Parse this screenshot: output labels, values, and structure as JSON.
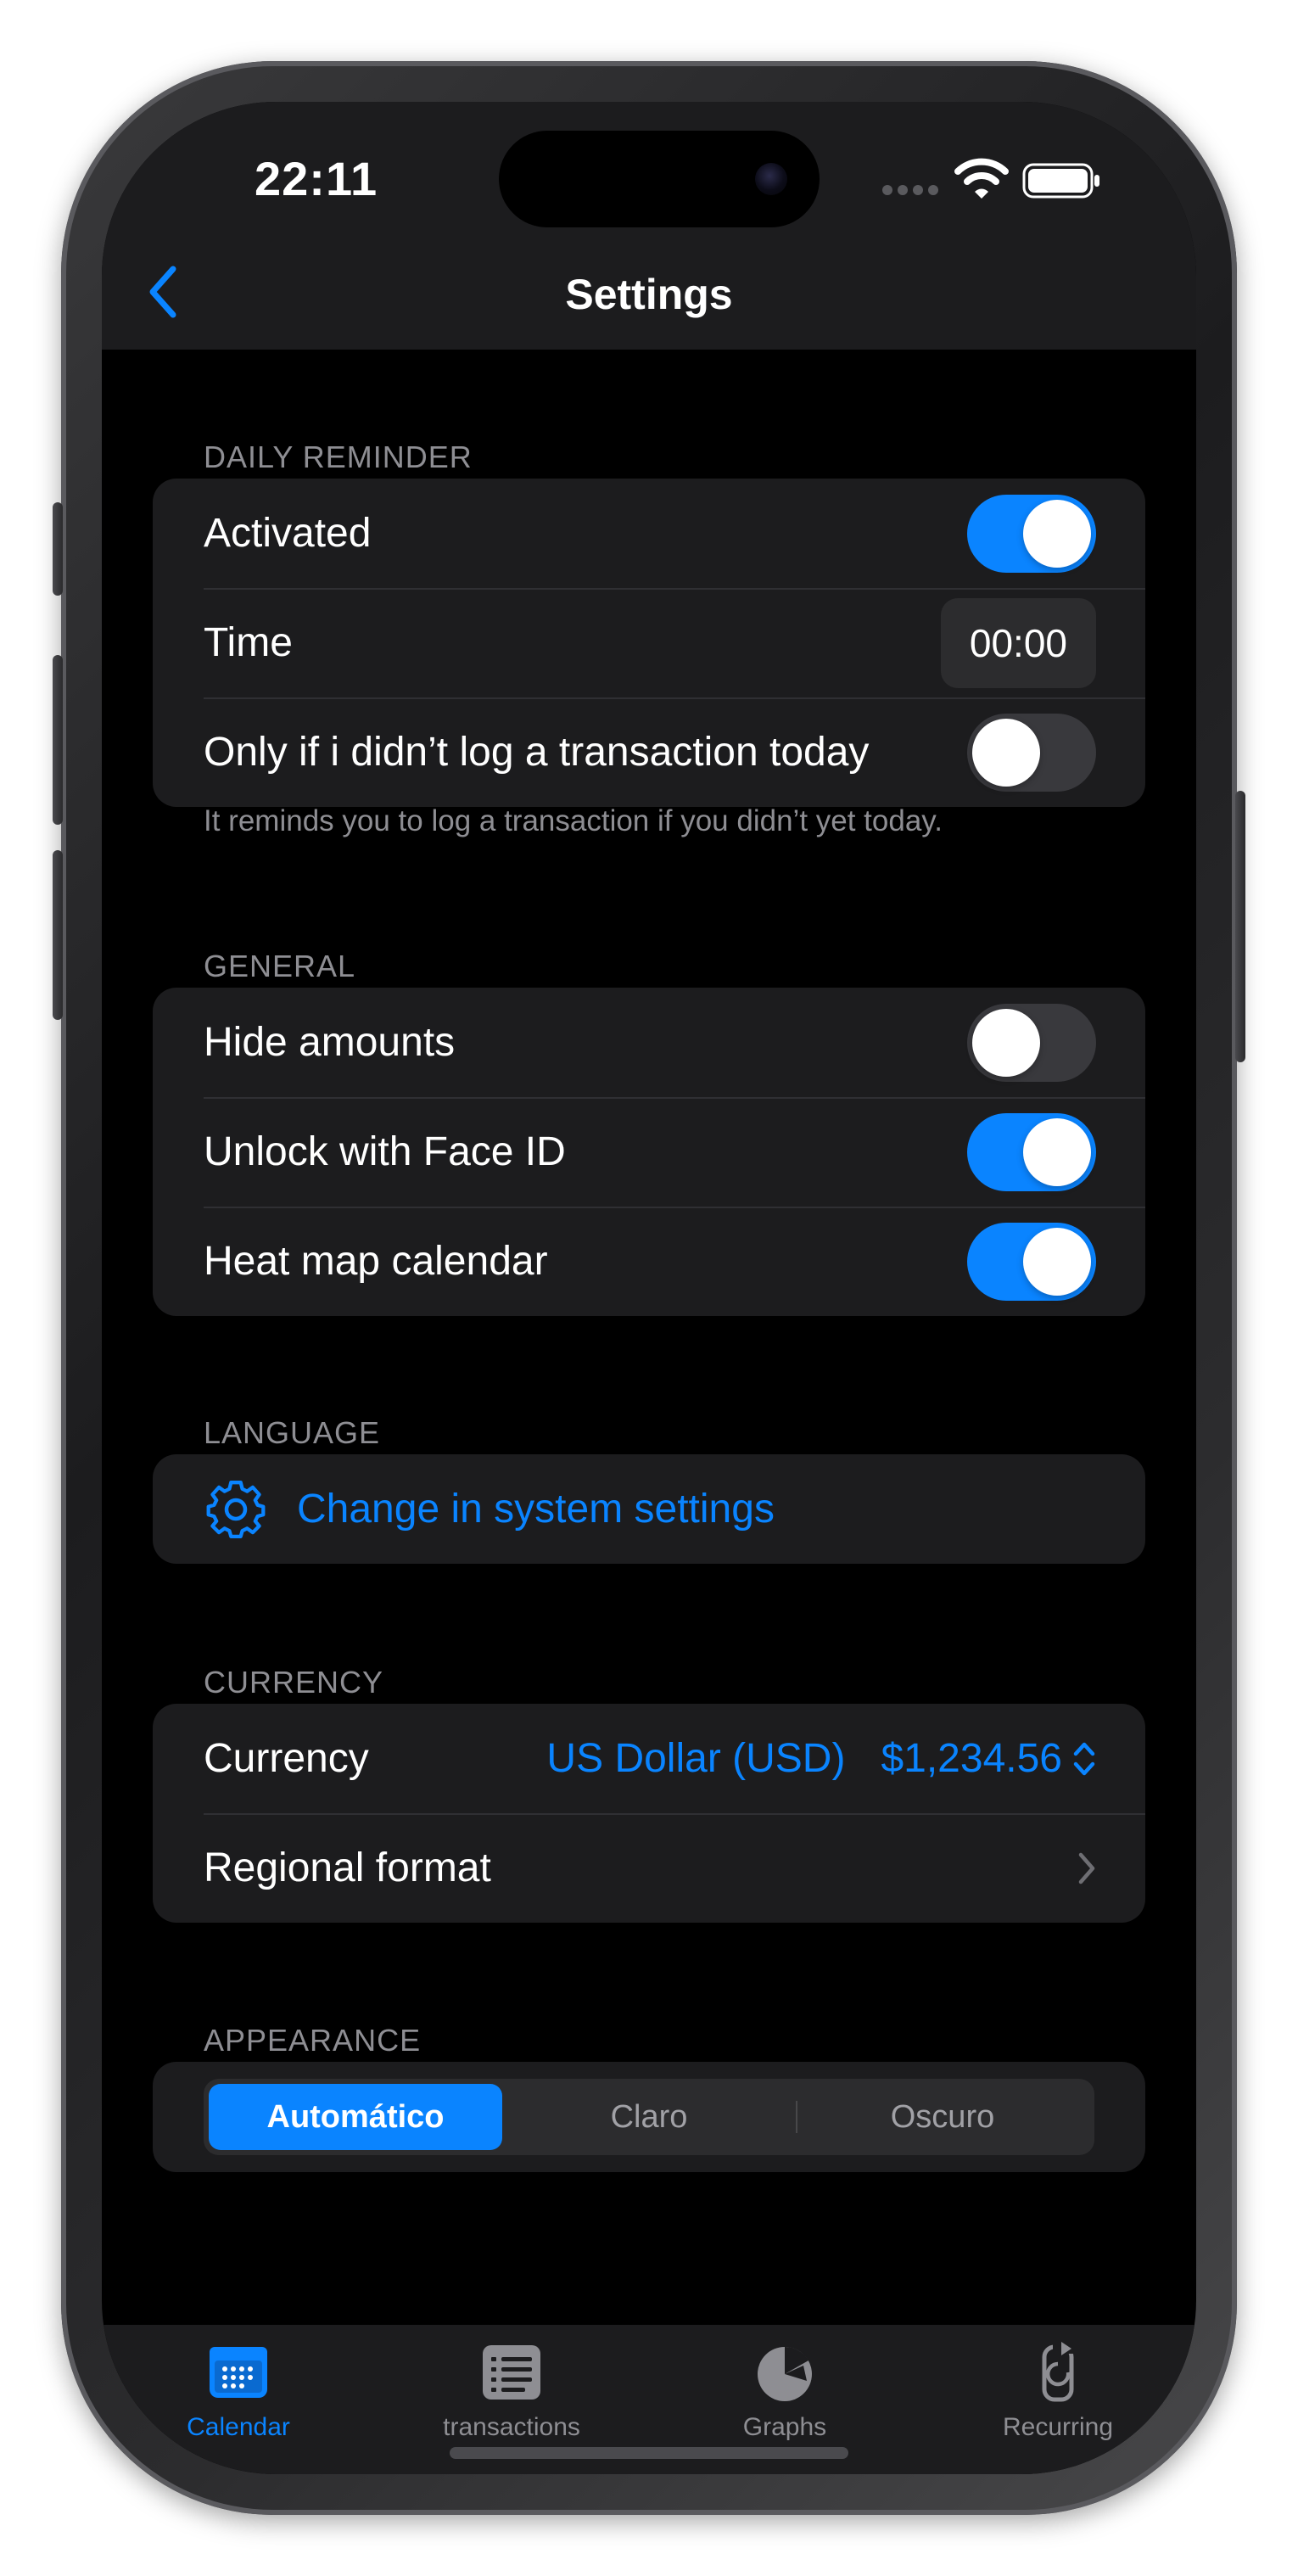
{
  "status_bar": {
    "time": "22:11"
  },
  "nav": {
    "title": "Settings"
  },
  "daily_reminder": {
    "header": "DAILY REMINDER",
    "activated_label": "Activated",
    "activated_on": true,
    "time_label": "Time",
    "time_value": "00:00",
    "only_if_label": "Only if i didn’t log a transaction today",
    "only_if_on": false,
    "footnote": "It reminds you to log a transaction if you didn’t yet today."
  },
  "general": {
    "header": "GENERAL",
    "hide_amounts_label": "Hide amounts",
    "hide_amounts_on": false,
    "face_id_label": "Unlock with Face ID",
    "face_id_on": true,
    "heat_map_label": "Heat map calendar",
    "heat_map_on": true
  },
  "language": {
    "header": "LANGUAGE",
    "link_label": "Change in system settings",
    "icon": "gear-icon"
  },
  "currency": {
    "header": "CURRENCY",
    "currency_label": "Currency",
    "currency_name": "US Dollar (USD)",
    "currency_sample": "$1,234.56",
    "regional_format_label": "Regional format"
  },
  "appearance": {
    "header": "APPEARANCE",
    "options": [
      "Automático",
      "Claro",
      "Oscuro"
    ],
    "selected": "Automático"
  },
  "tab_bar": {
    "tabs": [
      {
        "label": "Calendar",
        "icon": "calendar-icon",
        "active": true
      },
      {
        "label": "transactions",
        "icon": "list-icon",
        "active": false
      },
      {
        "label": "Graphs",
        "icon": "pie-chart-icon",
        "active": false
      },
      {
        "label": "Recurring",
        "icon": "recurring-icon",
        "active": false
      }
    ]
  },
  "colors": {
    "accent": "#0a84ff",
    "background": "#000000",
    "card": "#1c1c1e",
    "secondary_text": "#8e8e93"
  }
}
